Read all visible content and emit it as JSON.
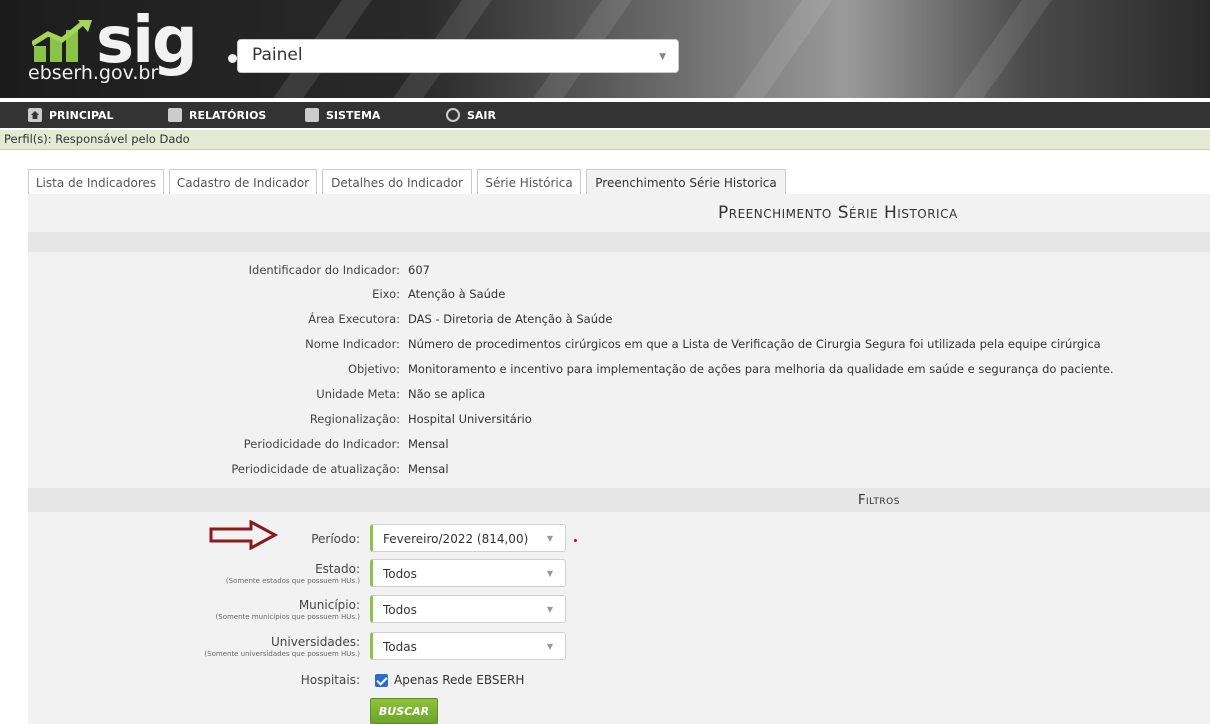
{
  "brand": {
    "logo_text": "sig",
    "domain": "ebserh.gov.br"
  },
  "panel_select": {
    "value": "Painel"
  },
  "nav": {
    "items": [
      {
        "label": "PRINCIPAL",
        "icon": "home-icon"
      },
      {
        "label": "RELATÓRIOS",
        "icon": "chart-icon"
      },
      {
        "label": "SISTEMA",
        "icon": "gear-icon"
      },
      {
        "label": "SAIR",
        "icon": "power-icon"
      }
    ]
  },
  "perfil": "Perfil(s): Responsável pelo Dado",
  "tabs": [
    {
      "label": "Lista de Indicadores",
      "active": false
    },
    {
      "label": "Cadastro de Indicador",
      "active": false
    },
    {
      "label": "Detalhes do Indicador",
      "active": false
    },
    {
      "label": "Série Histórica",
      "active": false
    },
    {
      "label": "Preenchimento Série Historica",
      "active": true
    }
  ],
  "page_title": "Preenchimento Série Historica",
  "details": [
    {
      "label": "Identificador do Indicador:",
      "value": "607"
    },
    {
      "label": "Eixo:",
      "value": "Atenção à Saúde"
    },
    {
      "label": "Área Executora:",
      "value": "DAS - Diretoria de Atenção à Saúde"
    },
    {
      "label": "Nome Indicador:",
      "value": "Número de procedimentos cirúrgicos em que a Lista de Verificação de Cirurgia Segura foi utilizada pela equipe cirúrgica"
    },
    {
      "label": "Objetivo:",
      "value": "Monitoramento e incentivo para implementação de ações para melhoria da qualidade em saúde e segurança do paciente."
    },
    {
      "label": "Unidade Meta:",
      "value": "Não se aplica"
    },
    {
      "label": "Regionalização:",
      "value": "Hospital Universitário"
    },
    {
      "label": "Periodicidade do Indicador:",
      "value": "Mensal"
    },
    {
      "label": "Periodicidade de atualização:",
      "value": "Mensal"
    }
  ],
  "filters": {
    "title": "Filtros",
    "periodo": {
      "label": "Período:",
      "value": "Fevereiro/2022 (814,00)"
    },
    "estado": {
      "label": "Estado:",
      "sub": "(Somente estados que possuem HUs.)",
      "value": "Todos"
    },
    "municipio": {
      "label": "Município:",
      "sub": "(Somente municípios que possuem HUs.)",
      "value": "Todos"
    },
    "universidades": {
      "label": "Universidades:",
      "sub": "(Somente universidades que possuem HUs.)",
      "value": "Todas"
    },
    "hospitais": {
      "label": "Hospitais:",
      "checkbox_label": "Apenas Rede EBSERH",
      "checked": true
    },
    "buscar_label": "BUSCAR"
  },
  "colors": {
    "accent_green": "#7cb342",
    "nav_bg": "#333333",
    "arrow_red": "#8b1a1a",
    "checkbox_blue": "#2b6cd4"
  }
}
